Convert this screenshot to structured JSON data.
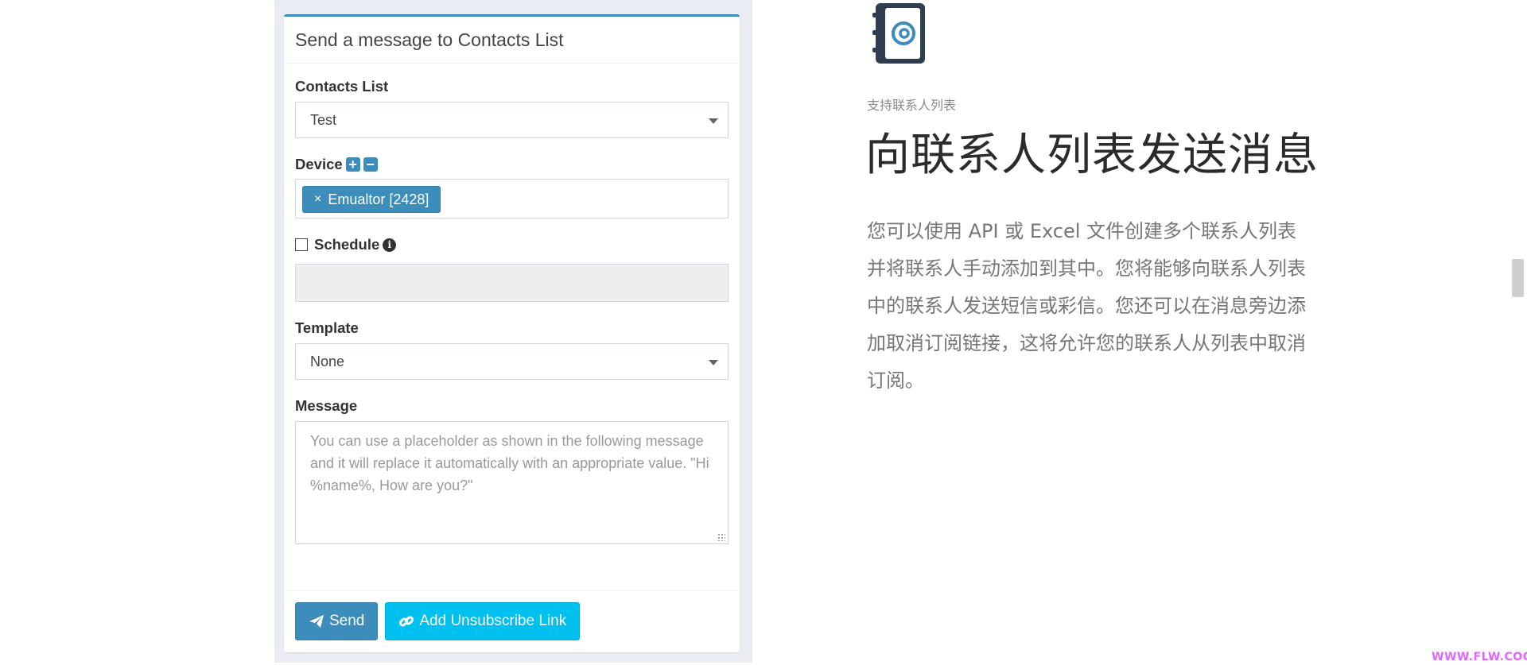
{
  "panel": {
    "title": "Send a message to Contacts List",
    "contacts_list": {
      "label": "Contacts List",
      "value": "Test"
    },
    "device": {
      "label": "Device",
      "add_icon": "plus-square-icon",
      "remove_icon": "minus-square-icon",
      "tag": "Emualtor [2428]",
      "tag_remove": "×"
    },
    "schedule": {
      "label": "Schedule",
      "info_icon": "info-circle-icon",
      "checked": false
    },
    "template": {
      "label": "Template",
      "value": "None"
    },
    "message": {
      "label": "Message",
      "placeholder": "You can use a placeholder as shown in the following message and it will replace it automatically with an appropriate value. \"Hi %name%, How are you?\""
    },
    "buttons": {
      "send": "Send",
      "add_unsubscribe": "Add Unsubscribe Link"
    }
  },
  "feature": {
    "icon": "address-book-at-icon",
    "eyebrow": "支持联系人列表",
    "headline": "向联系人列表发送消息",
    "description": "您可以使用 API 或 Excel 文件创建多个联系人列表并将联系人手动添加到其中。您将能够向联系人列表中的联系人发送短信或彩信。您还可以在消息旁边添加取消订阅链接，这将允许您的联系人从列表中取消订阅。"
  },
  "watermark": "WWW.FLW.COOL",
  "colors": {
    "primary": "#3c8dbc",
    "info": "#00c0ef",
    "icon_dark": "#2e3e50"
  }
}
